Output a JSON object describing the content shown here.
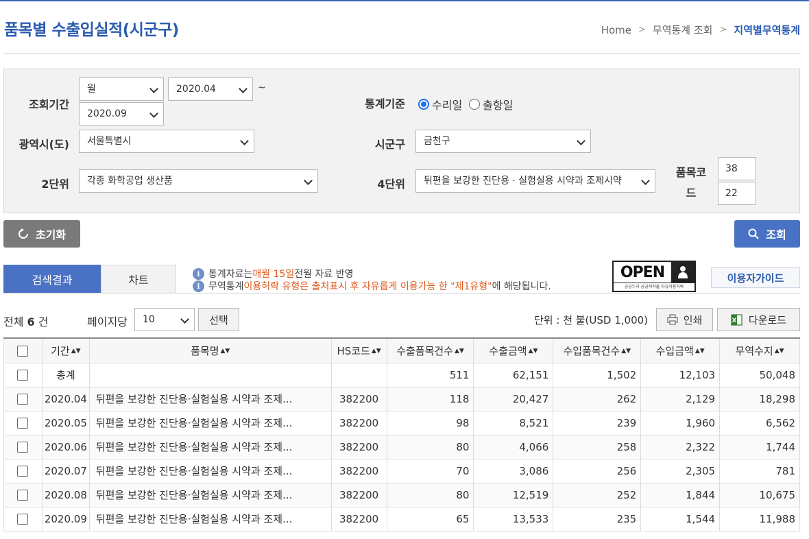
{
  "header": {
    "title": "품목별 수출입실적(시군구)",
    "breadcrumb": [
      "Home",
      "무역통계 조회",
      "지역별무역통계"
    ]
  },
  "search": {
    "period_label": "조회기간",
    "period_unit": "월",
    "period_from": "2020.04",
    "period_tilde": "~",
    "period_to": "2020.09",
    "basis_label": "통계기준",
    "basis_options": [
      "수리일",
      "출항일"
    ],
    "basis_selected": "수리일",
    "city_label": "광역시(도)",
    "city_value": "서울특별시",
    "district_label": "시군구",
    "district_value": "금천구",
    "unit2_label": "2단위",
    "unit2_value": "각종 화학공업 생산품",
    "unit4_label": "4단위",
    "unit4_value": "뒤편을 보강한 진단용 · 실험실용 시약과 조제시약",
    "code_label": "품목코드",
    "code_1": "38",
    "code_2": "22"
  },
  "buttons": {
    "reset": "초기화",
    "search": "조회",
    "select": "선택",
    "print": "인쇄",
    "download": "다운로드",
    "guide": "이용자가이드"
  },
  "tabs": [
    "검색결과",
    "차트"
  ],
  "notices": {
    "line1_pre": "통계자료는 ",
    "line1_hl": "매월 15일",
    "line1_post": " 전월 자료 반영",
    "line2_pre": "무역통계 ",
    "line2_hl": "이용허락 유형은 출처표시 후 자유롭게 이용가능 한 \"제1유형\"",
    "line2_post": "에 해당됩니다."
  },
  "open_logo": {
    "word": "OPEN",
    "caption": "공공누리  공공저작물 자유이용허락"
  },
  "result": {
    "total_pre": "전체 ",
    "total_count": "6",
    "total_post": " 건",
    "per_page_label": "페이지당",
    "per_page_value": "10",
    "unit_text": "단위 : 천 불(USD 1,000)"
  },
  "table": {
    "headers": [
      "기간",
      "품목명",
      "HS코드",
      "수출품목건수",
      "수출금액",
      "수입품목건수",
      "수입금액",
      "무역수지"
    ],
    "rows": [
      [
        "총계",
        "",
        "",
        "511",
        "62,151",
        "1,502",
        "12,103",
        "50,048"
      ],
      [
        "2020.04",
        "뒤편을 보강한 진단용·실험실용 시약과 조제...",
        "382200",
        "118",
        "20,427",
        "262",
        "2,129",
        "18,298"
      ],
      [
        "2020.05",
        "뒤편을 보강한 진단용·실험실용 시약과 조제...",
        "382200",
        "98",
        "8,521",
        "239",
        "1,960",
        "6,562"
      ],
      [
        "2020.06",
        "뒤편을 보강한 진단용·실험실용 시약과 조제...",
        "382200",
        "80",
        "4,066",
        "258",
        "2,322",
        "1,744"
      ],
      [
        "2020.07",
        "뒤편을 보강한 진단용·실험실용 시약과 조제...",
        "382200",
        "70",
        "3,086",
        "256",
        "2,305",
        "781"
      ],
      [
        "2020.08",
        "뒤편을 보강한 진단용·실험실용 시약과 조제...",
        "382200",
        "80",
        "12,519",
        "252",
        "1,844",
        "10,675"
      ],
      [
        "2020.09",
        "뒤편을 보강한 진단용·실험실용 시약과 조제...",
        "382200",
        "65",
        "13,533",
        "235",
        "1,544",
        "11,988"
      ]
    ]
  },
  "colors": {
    "accent": "#4a72c4",
    "title": "#2a5bb0",
    "highlight": "#e05a1e"
  }
}
